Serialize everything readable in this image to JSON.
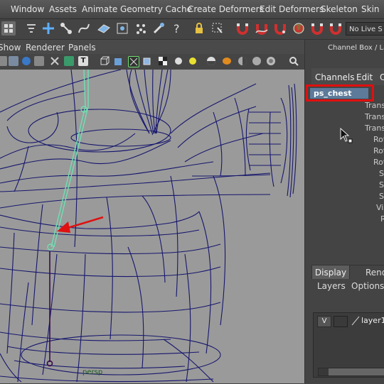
{
  "menubar": {
    "items": [
      "Window",
      "Assets",
      "Animate",
      "Geometry Cache",
      "Create Deformers",
      "Edit Deformers",
      "Skeleton",
      "Skin"
    ]
  },
  "shelf": {
    "live_surface_label": "No Live S"
  },
  "panel_menu": {
    "items": [
      "Show",
      "Renderer",
      "Panels"
    ]
  },
  "viewport": {
    "camera_label": "persp"
  },
  "channel_box": {
    "title": "Channel Box / Lay",
    "menu": [
      "Channels",
      "Edit",
      "O"
    ],
    "object_name": "ps_chest",
    "attributes": [
      "Trans",
      "Trans",
      "Trans",
      "Rot",
      "Rot",
      "Rot",
      "S",
      "S",
      "S",
      "Vis",
      "R"
    ]
  },
  "layer_editor": {
    "tabs": [
      "Display",
      "Rend"
    ],
    "menu": [
      "Layers",
      "Options"
    ],
    "visibility": "V",
    "layer_name": "layer1"
  },
  "colors": {
    "highlight_box": "#e01010",
    "selected_object": "#5d7a9a",
    "wireframe": "#16166e",
    "joint_selected": "#6fe0b4",
    "arrow": "#e01010"
  }
}
